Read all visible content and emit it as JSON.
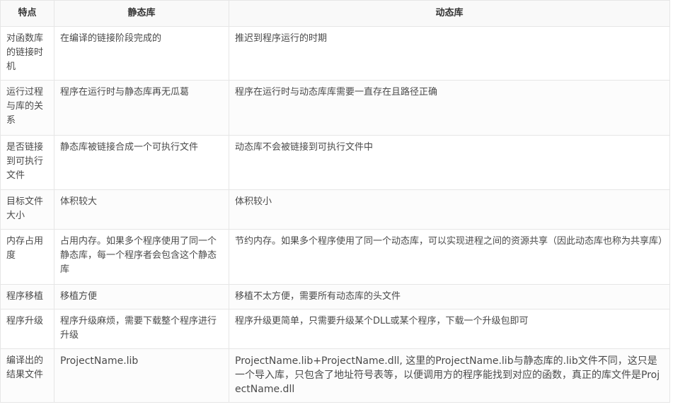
{
  "headers": [
    "特点",
    "静态库",
    "动态库"
  ],
  "rows": [
    {
      "feature": "对函数库的链接时机",
      "static": "在编译的链接阶段完成的",
      "dynamic": "推迟到程序运行的时期"
    },
    {
      "feature": "运行过程与库的关系",
      "static": "程序在运行时与静态库再无瓜葛",
      "dynamic": "程序在运行时与动态库库需要一直存在且路径正确"
    },
    {
      "feature": "是否链接到可执行文件",
      "static": "静态库被链接合成一个可执行文件",
      "dynamic": "动态库不会被链接到可执行文件中"
    },
    {
      "feature": "目标文件大小",
      "static": "体积较大",
      "dynamic": "体积较小"
    },
    {
      "feature": "内存占用度",
      "static": "占用内存。如果多个程序使用了同一个静态库，每一个程序者会包含这个静态库",
      "dynamic": "节约内存。如果多个程序使用了同一个动态库，可以实现进程之间的资源共享（因此动态库也称为共享库）"
    },
    {
      "feature": "程序移植",
      "static": "移植方便",
      "dynamic": "移植不太方便，需要所有动态库的头文件"
    },
    {
      "feature": "程序升级",
      "static": "程序升级麻烦，需要下载整个程序进行升级",
      "dynamic": "程序升级更简单，只需要升级某个DLL或某个程序，下载一个升级包即可"
    },
    {
      "feature": "编译出的结果文件",
      "static": "ProjectName.lib",
      "dynamic": "ProjectName.lib+ProjectName.dll, 这里的ProjectName.lib与静态库的.lib文件不同，这只是一个导入库，只包含了地址符号表等，以便调用方的程序能找到对应的函数，真正的库文件是ProjectName.dll"
    }
  ]
}
